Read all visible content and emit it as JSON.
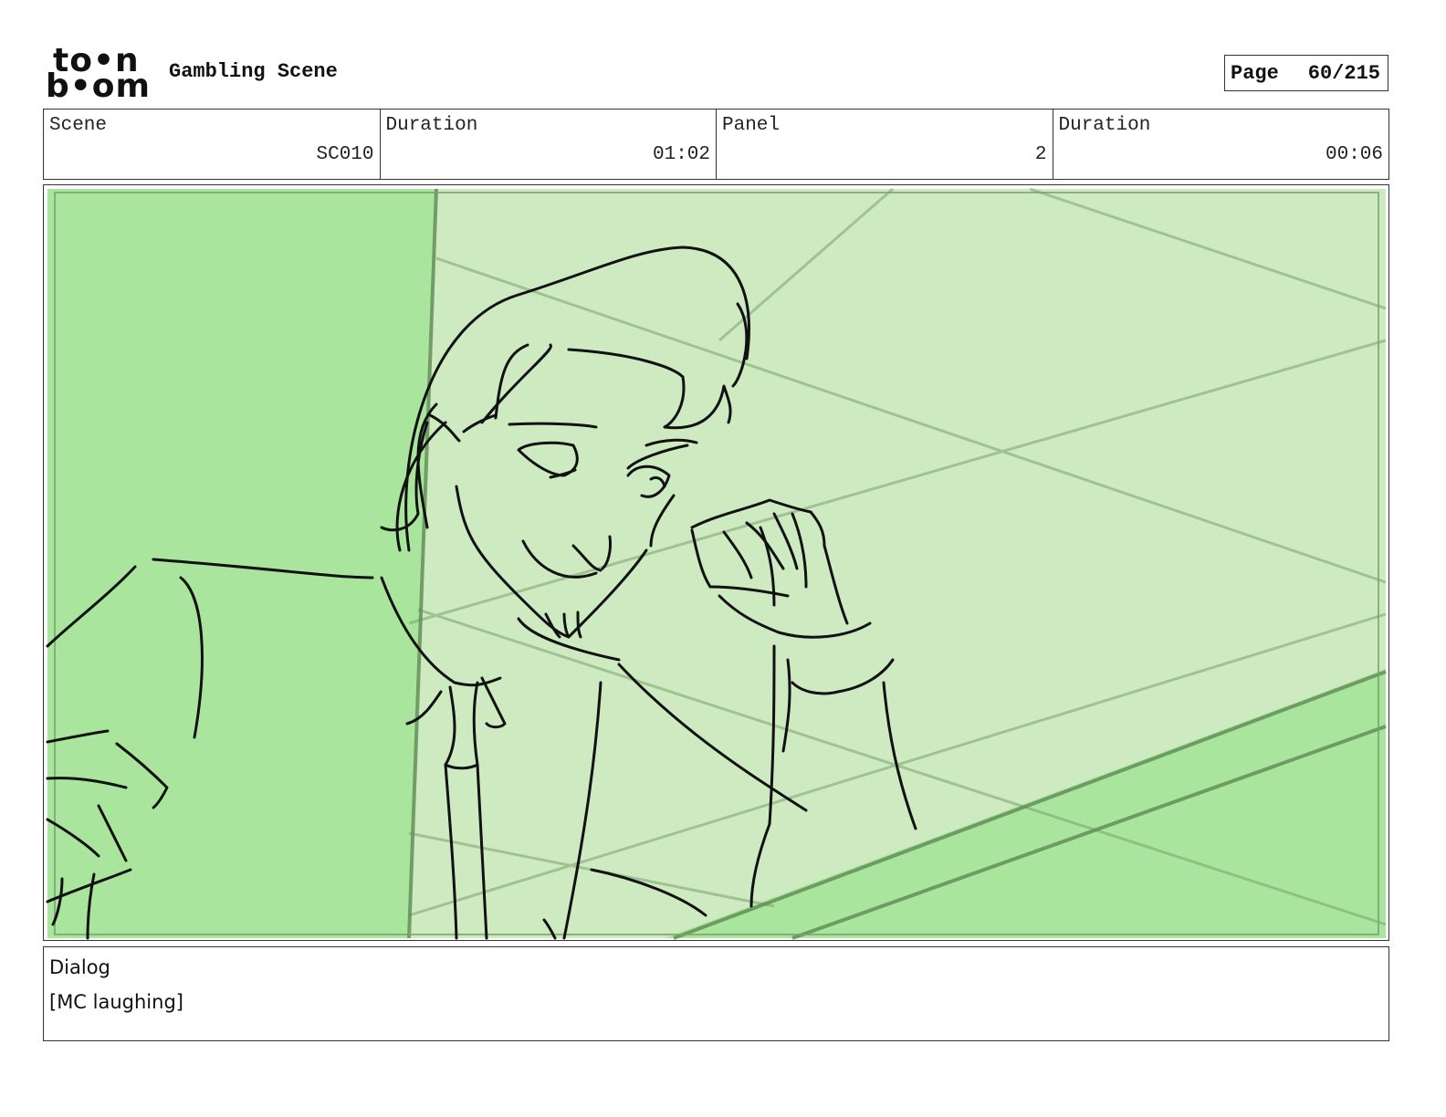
{
  "header": {
    "logo_top": "to•n",
    "logo_bottom": "b•om",
    "project_title": "Gambling Scene",
    "page_label": "Page",
    "page_value": "60/215"
  },
  "info": {
    "scene_label": "Scene",
    "scene_value": "SC010",
    "scene_duration_label": "Duration",
    "scene_duration_value": "01:02",
    "panel_label": "Panel",
    "panel_value": "2",
    "panel_duration_label": "Duration",
    "panel_duration_value": "00:06"
  },
  "panel": {
    "description": "storyboard-sketch",
    "colors": {
      "wall_dark": "#a9e59c",
      "wall_light": "#cdeac0",
      "table": "#a9e59c",
      "line": "#111111",
      "guide": "#7aa36e"
    }
  },
  "dialog": {
    "label": "Dialog",
    "text": "[MC laughing]"
  }
}
